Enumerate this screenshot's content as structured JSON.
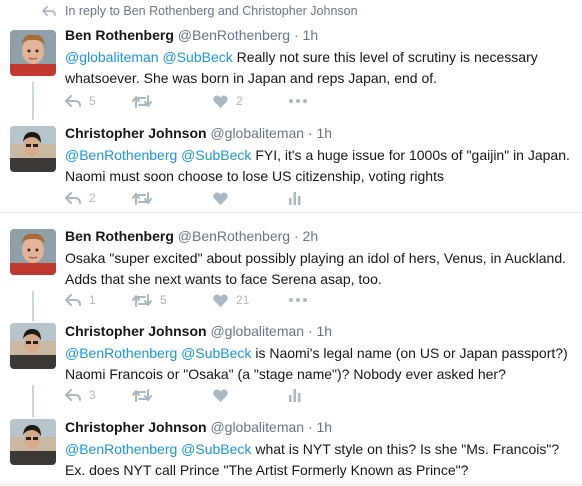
{
  "reply_context": {
    "prefix": "In reply to ",
    "names": "Ben Rothenberg and Christopher Johnson"
  },
  "colors": {
    "link": "#1b95e0",
    "muted": "#657786",
    "icon": "#aab8c2",
    "thread_line": "#ccd6dd"
  },
  "tweets": [
    {
      "name": "Ben Rothenberg",
      "handle": "@BenRothenberg",
      "sep": "·",
      "time": "1h",
      "mentions": "@globaliteman @SubBeck",
      "text": " Really not sure this level of scrutiny is necessary whatsoever. She was born in Japan and reps Japan, end of.",
      "actions": {
        "reply": "5",
        "retweet": "",
        "like": "2",
        "extra_icon": "more-icon"
      }
    },
    {
      "name": "Christopher Johnson",
      "handle": "@globaliteman",
      "sep": "·",
      "time": "1h",
      "mentions": "@BenRothenberg @SubBeck",
      "text": " FYI, it's a huge issue for 1000s of \"gaijin\" in Japan. Naomi must soon choose to lose US citizenship, voting rights",
      "actions": {
        "reply": "2",
        "retweet": "",
        "like": "",
        "extra_icon": "analytics-icon"
      }
    },
    {
      "name": "Ben Rothenberg",
      "handle": "@BenRothenberg",
      "sep": "·",
      "time": "2h",
      "mentions": "",
      "text": "Osaka \"super excited\" about possibly playing an idol of hers, Venus, in Auckland. Adds that she next wants to face Serena asap, too.",
      "actions": {
        "reply": "1",
        "retweet": "5",
        "like": "21",
        "extra_icon": "more-icon"
      }
    },
    {
      "name": "Christopher Johnson",
      "handle": "@globaliteman",
      "sep": "·",
      "time": "1h",
      "mentions": "@BenRothenberg @SubBeck",
      "text": " is Naomi's legal name (on US or Japan passport?) Naomi Francois or \"Osaka\" (a \"stage name\")? Nobody ever asked her?",
      "actions": {
        "reply": "3",
        "retweet": "",
        "like": "",
        "extra_icon": "analytics-icon"
      }
    },
    {
      "name": "Christopher Johnson",
      "handle": "@globaliteman",
      "sep": "·",
      "time": "1h",
      "mentions": "@BenRothenberg @SubBeck",
      "text": " what is NYT style on this? Is she \"Ms. Francois\"? Ex. does NYT call Prince \"The Artist Formerly Known as Prince\"?",
      "actions": {
        "reply": "",
        "retweet": "",
        "like": "",
        "extra_icon": ""
      }
    }
  ]
}
